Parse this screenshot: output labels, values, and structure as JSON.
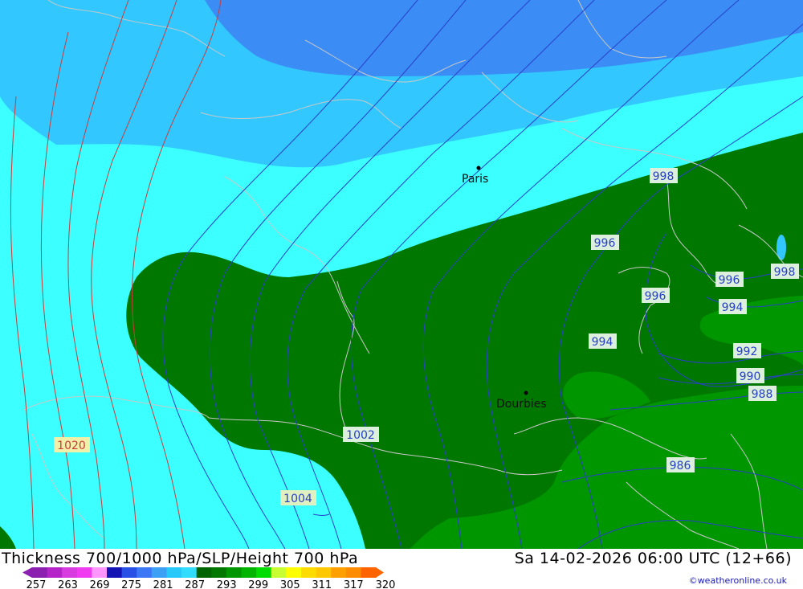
{
  "title": "Thickness 700/1000 hPa/SLP/Height 700 hPa",
  "datetime": "Sa 14-02-2026 06:00 UTC (12+66)",
  "credit": "©weatheronline.co.uk",
  "colorbar": {
    "ticks": [
      "257",
      "263",
      "269",
      "275",
      "281",
      "287",
      "293",
      "299",
      "305",
      "311",
      "317",
      "320"
    ],
    "colors": [
      "#8a1fb0",
      "#b524c8",
      "#d83ce0",
      "#f03cf0",
      "#ff96ff",
      "#1414b4",
      "#2850e6",
      "#3c78f5",
      "#3ca0f5",
      "#28c8fa",
      "#32dcff",
      "#006400",
      "#007800",
      "#009600",
      "#00b400",
      "#00dc00",
      "#c8ff32",
      "#ffff00",
      "#ffdc00",
      "#ffc800",
      "#ffa000",
      "#ff8c00",
      "#ff6400"
    ]
  },
  "cities": [
    {
      "name": "Paris"
    },
    {
      "name": "Dourbies"
    }
  ],
  "isobar_labels": [
    {
      "value": "998"
    },
    {
      "value": "996"
    },
    {
      "value": "998"
    },
    {
      "value": "996"
    },
    {
      "value": "996"
    },
    {
      "value": "994"
    },
    {
      "value": "994"
    },
    {
      "value": "992"
    },
    {
      "value": "990"
    },
    {
      "value": "988"
    },
    {
      "value": "986"
    },
    {
      "value": "1002"
    },
    {
      "value": "1004"
    },
    {
      "value": "1020"
    }
  ],
  "colors": {
    "band_275": "#3c8cf5",
    "band_278": "#32c8ff",
    "band_281": "#3cffff",
    "band_287": "#007800",
    "band_290": "#009600",
    "isobar_blue": "#2840c8",
    "isobar_red": "#c83c3c",
    "coast": "#c8c8c8"
  }
}
